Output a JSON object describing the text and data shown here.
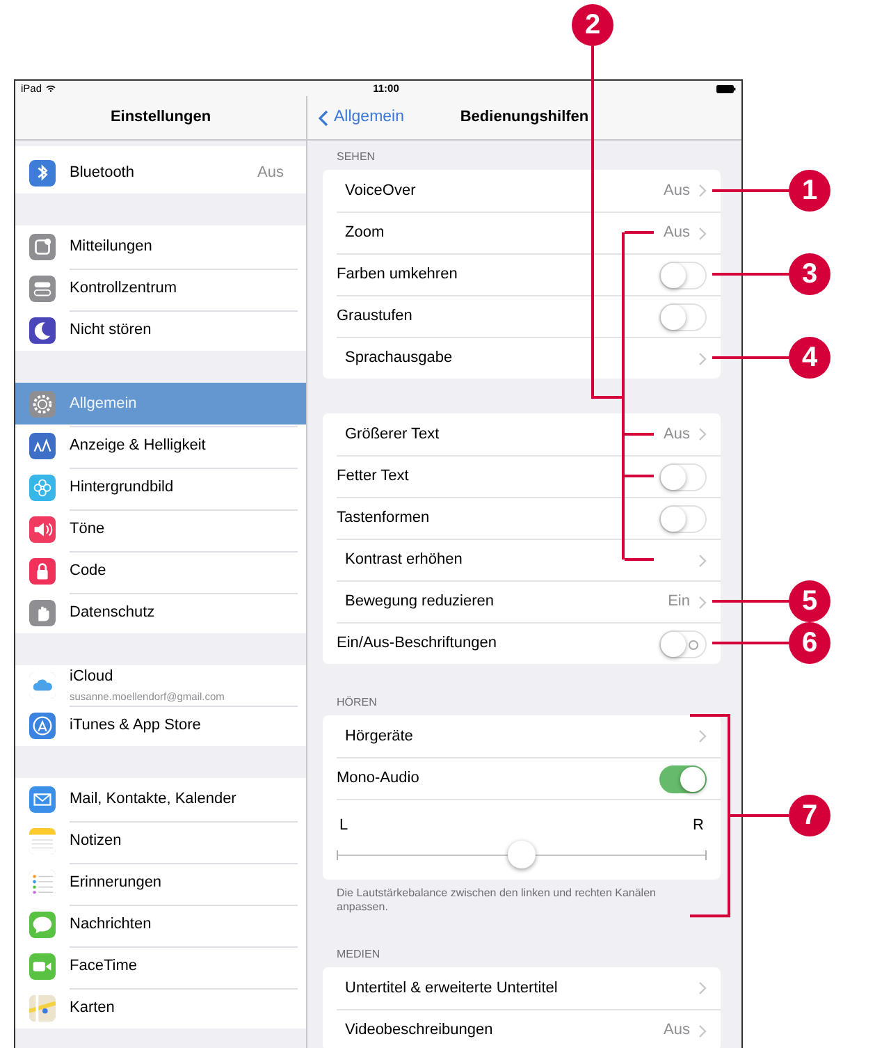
{
  "status_bar": {
    "device": "iPad",
    "time": "11:00"
  },
  "sidebar": {
    "title": "Einstellungen",
    "groups": [
      [
        {
          "label": "Bluetooth",
          "value": "Aus",
          "color": "#3d7dd8",
          "selected": false
        }
      ],
      [
        {
          "label": "Mitteilungen",
          "color": "#8e8e93",
          "selected": false
        },
        {
          "label": "Kontrollzentrum",
          "color": "#8e8e93",
          "selected": false
        },
        {
          "label": "Nicht stören",
          "color": "#4a45b8",
          "selected": false
        }
      ],
      [
        {
          "label": "Allgemein",
          "color": "#8e8e93",
          "selected": true
        },
        {
          "label": "Anzeige & Helligkeit",
          "color": "#3d6fc6",
          "selected": false
        },
        {
          "label": "Hintergrundbild",
          "color": "#38b6ea",
          "selected": false
        },
        {
          "label": "Töne",
          "color": "#f03a5f",
          "selected": false
        },
        {
          "label": "Code",
          "color": "#f0325a",
          "selected": false
        },
        {
          "label": "Datenschutz",
          "color": "#8e8e93",
          "selected": false
        }
      ],
      [
        {
          "label": "iCloud",
          "subtitle": "susanne.moellendorf@gmail.com",
          "color": "#ffffff",
          "selected": false
        },
        {
          "label": "iTunes & App Store",
          "color": "#3a84e0",
          "selected": false
        }
      ],
      [
        {
          "label": "Mail, Kontakte, Kalender",
          "color": "#3a90e8",
          "selected": false
        },
        {
          "label": "Notizen",
          "color": "#ffffff",
          "selected": false
        },
        {
          "label": "Erinnerungen",
          "color": "#ffffff",
          "selected": false
        },
        {
          "label": "Nachrichten",
          "color": "#5ac243",
          "selected": false
        },
        {
          "label": "FaceTime",
          "color": "#5ac243",
          "selected": false
        },
        {
          "label": "Karten",
          "color": "#ece4cc",
          "selected": false
        }
      ]
    ]
  },
  "detail": {
    "back": "Allgemein",
    "title": "Bedienungshilfen",
    "bracket_callout": "2",
    "sections": [
      {
        "header": "SEHEN",
        "rows": [
          {
            "kind": "link",
            "label": "VoiceOver",
            "value": "Aus",
            "callout": "1"
          },
          {
            "kind": "link",
            "label": "Zoom",
            "value": "Aus",
            "bracketed": true
          },
          {
            "kind": "toggle",
            "label": "Farben umkehren",
            "on": false,
            "callout": "3"
          },
          {
            "kind": "toggle",
            "label": "Graustufen",
            "on": false
          },
          {
            "kind": "link",
            "label": "Sprachausgabe",
            "callout": "4"
          }
        ]
      },
      {
        "rows": [
          {
            "kind": "link",
            "label": "Größerer Text",
            "value": "Aus",
            "bracketed": true
          },
          {
            "kind": "toggle",
            "label": "Fetter Text",
            "on": false,
            "bracketed": true
          },
          {
            "kind": "toggle",
            "label": "Tastenformen",
            "on": false
          },
          {
            "kind": "link",
            "label": "Kontrast erhöhen",
            "bracketed": true
          },
          {
            "kind": "link",
            "label": "Bewegung reduzieren",
            "value": "Ein",
            "callout": "5"
          },
          {
            "kind": "labeled_toggle",
            "label": "Ein/Aus-Beschriftungen",
            "on": false,
            "callout": "6"
          }
        ]
      },
      {
        "header": "HÖREN",
        "callout": "7",
        "rows": [
          {
            "kind": "link",
            "label": "Hörgeräte"
          },
          {
            "kind": "toggle",
            "label": "Mono-Audio",
            "on": true
          },
          {
            "kind": "slider",
            "left": "L",
            "right": "R",
            "level": 0.5
          }
        ],
        "footer": "Die Lautstärkebalance zwischen den linken und rechten Kanälen anpassen."
      },
      {
        "header": "MEDIEN",
        "rows": [
          {
            "kind": "link",
            "label": "Untertitel & erweiterte Untertitel"
          },
          {
            "kind": "link",
            "label": "Videobeschreibungen",
            "value": "Aus"
          }
        ]
      }
    ]
  }
}
